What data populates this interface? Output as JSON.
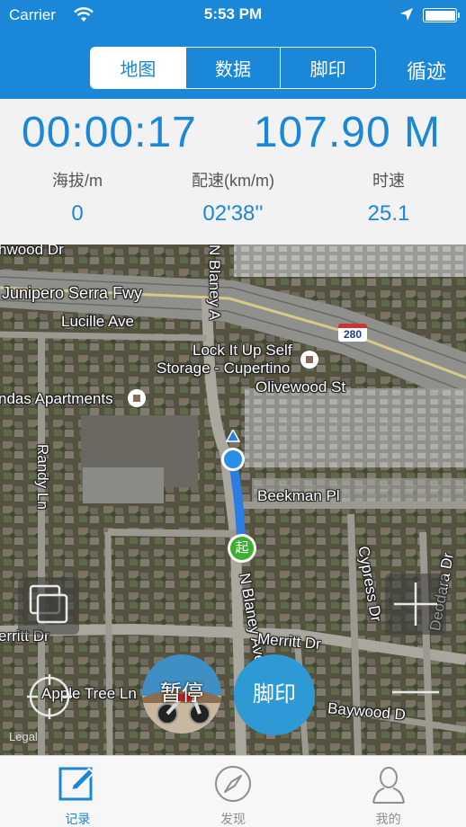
{
  "status_bar": {
    "carrier": "Carrier",
    "time": "5:53 PM"
  },
  "nav": {
    "tabs": [
      {
        "label": "地图",
        "active": true
      },
      {
        "label": "数据",
        "active": false
      },
      {
        "label": "脚印",
        "active": false
      }
    ],
    "right_link": "循迹"
  },
  "stats": {
    "duration": "00:00:17",
    "distance": "107.90 M",
    "altitude": {
      "label": "海拔/m",
      "value": "0"
    },
    "pace": {
      "label": "配速(km/m)",
      "value": "02'38''"
    },
    "speed": {
      "label": "时速",
      "value": "25.1"
    }
  },
  "map": {
    "labels": {
      "hawkwood": "hwood Dr",
      "junipero": "Junipero Serra Fwy",
      "lucille": "Lucille Ave",
      "lockitup": "Lock It Up Self",
      "storage": "Storage - Cupertino",
      "olivewood": "Olivewood St",
      "andas": "ndas Apartments",
      "randy": "Randy Ln",
      "beekman": "Beekman Pl",
      "nblaney_top": "N Blaney A",
      "nblaney_bottom": "N Blaney Ave",
      "cypress": "Cypress Dr",
      "deodara": "Deodara Dr",
      "merritt_left": "erritt Dr",
      "merritt_right": "Merritt Dr",
      "appletree": "Apple Tree Ln",
      "baywood": "Baywood D",
      "legal": "Legal",
      "shield": "280",
      "start_marker": "起"
    },
    "pause_label": "暂停",
    "footprint_label": "脚印",
    "colors": {
      "route": "#2a7de1",
      "start": "#3cb034",
      "accent": "#1a87d8"
    }
  },
  "tabbar": {
    "items": [
      {
        "label": "记录",
        "icon": "pencil-icon",
        "active": true
      },
      {
        "label": "发现",
        "icon": "compass-icon",
        "active": false
      },
      {
        "label": "我的",
        "icon": "person-icon",
        "active": false
      }
    ]
  }
}
